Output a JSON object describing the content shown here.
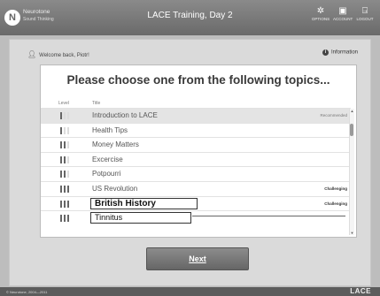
{
  "header": {
    "brand_name": "Neurotone",
    "brand_sub": "Sound Thinking",
    "title": "LACE Training, Day 2",
    "buttons": [
      {
        "label": "OPTIONS",
        "icon": "gear-icon"
      },
      {
        "label": "ACCOUNT",
        "icon": "lock-icon"
      },
      {
        "label": "LOGOUT",
        "icon": "door-icon"
      }
    ]
  },
  "welcome": "Welcome back, Piotr!",
  "info_label": "Information",
  "heading": "Please choose one from the following topics...",
  "columns": {
    "level": "Level",
    "title": "Title"
  },
  "topics": [
    {
      "title": "Introduction to LACE",
      "level": 1,
      "tag": "Recommended"
    },
    {
      "title": "Health Tips",
      "level": 1,
      "tag": ""
    },
    {
      "title": "Money Matters",
      "level": 2,
      "tag": ""
    },
    {
      "title": "Excercise",
      "level": 2,
      "tag": ""
    },
    {
      "title": "Potpourri",
      "level": 2,
      "tag": ""
    },
    {
      "title": "US Revolution",
      "level": 3,
      "tag": "Challenging"
    },
    {
      "title": "British History",
      "level": 3,
      "tag": "Challenging"
    },
    {
      "title": "Tinnitus",
      "level": 3,
      "tag": ""
    }
  ],
  "next_label": "Next",
  "footer": {
    "copyright": "© Neurotone, 2004—2011",
    "logo": "LACE"
  }
}
